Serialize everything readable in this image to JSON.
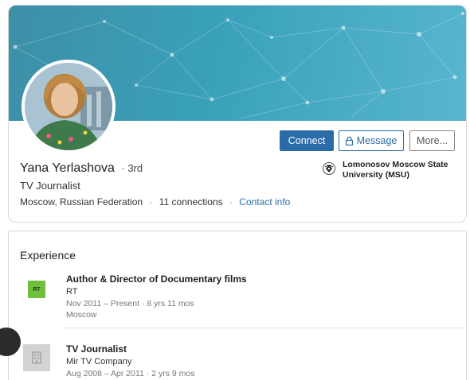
{
  "profile": {
    "name": "Yana Yerlashova",
    "degree": "3rd",
    "headline": "TV Journalist",
    "location": "Moscow, Russian Federation",
    "connections": "11 connections",
    "contact_info": "Contact info"
  },
  "actions": {
    "connect": "Connect",
    "message": "Message",
    "more": "More..."
  },
  "education": {
    "school": "Lomonosov Moscow State University (MSU)"
  },
  "experience": {
    "title": "Experience",
    "jobs": [
      {
        "logo_text": "RT",
        "title": "Author & Director of Documentary films",
        "company": "RT",
        "dates": "Nov 2011 – Present · 8 yrs 11 mos",
        "location": "Moscow"
      },
      {
        "title": "TV Journalist",
        "company": "Mir TV Company",
        "dates": "Aug 2008 – Apr 2011 · 2 yrs 9 mos"
      }
    ]
  },
  "colors": {
    "brand_blue": "#2a6ca8",
    "banner": "#3aa1bb",
    "rt_green": "#6fbf3b"
  }
}
